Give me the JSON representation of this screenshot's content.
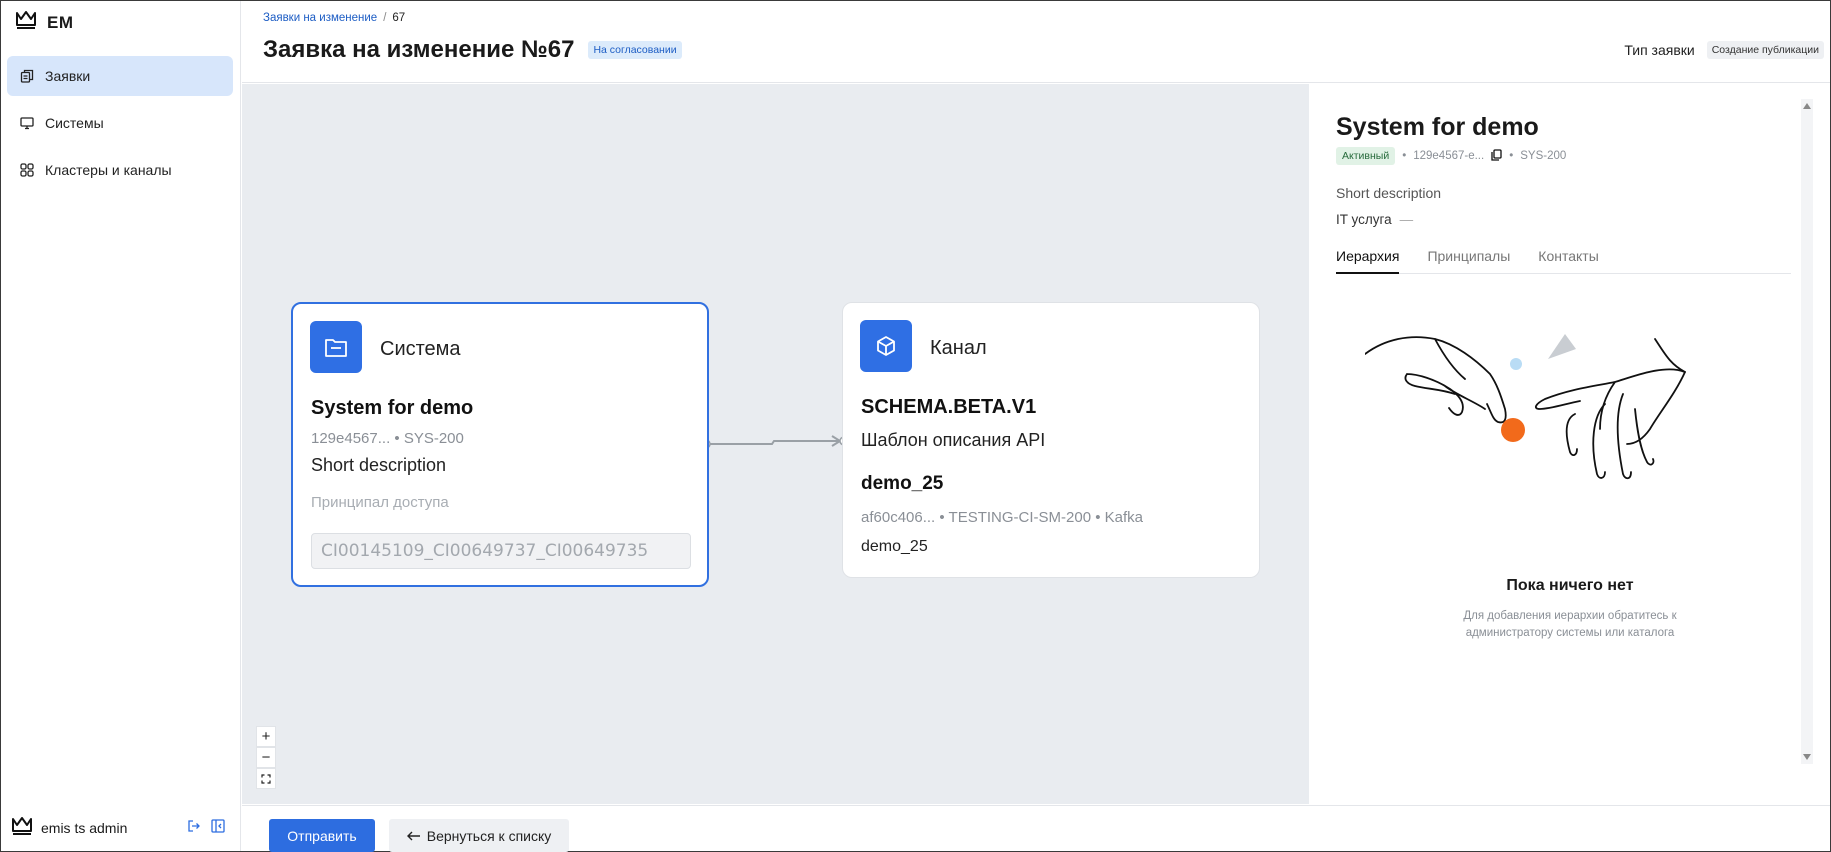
{
  "app": {
    "logo_text": "EM"
  },
  "sidebar": {
    "items": [
      {
        "label": "Заявки",
        "icon": "requests-icon",
        "active": true
      },
      {
        "label": "Системы",
        "icon": "monitor-icon",
        "active": false
      },
      {
        "label": "Кластеры и каналы",
        "icon": "grid-icon",
        "active": false
      }
    ],
    "user": {
      "name": "emis ts admin"
    }
  },
  "header": {
    "breadcrumb": {
      "parent": "Заявки на изменение",
      "separator": "/",
      "current": "67"
    },
    "title": "Заявка на изменение №67",
    "status_badge": "На согласовании",
    "type_label": "Тип заявки",
    "type_value": "Создание публикации"
  },
  "canvas": {
    "system_node": {
      "type_label": "Система",
      "name": "System for demo",
      "meta": "129e4567... • SYS-200",
      "description": "Short description",
      "principal_label": "Принципал доступа",
      "principal_value": "CI00145109_CI00649737_CI00649735"
    },
    "channel_node": {
      "type_label": "Канал",
      "name": "SCHEMA.BETA.V1",
      "subtitle": "Шаблон описания API",
      "cluster_name": "demo_25",
      "cluster_meta": "af60c406... • TESTING-CI-SM-200 • Kafka",
      "cluster_value": "demo_25"
    },
    "zoom": {
      "plus": "+",
      "minus": "−"
    }
  },
  "panel": {
    "title": "System for demo",
    "status": "Активный",
    "id": "129e4567-e...",
    "dot": "•",
    "code": "SYS-200",
    "description": "Short description",
    "it_service_label": "IT услуга",
    "it_service_value": "—",
    "tabs": [
      {
        "label": "Иерархия",
        "active": true
      },
      {
        "label": "Принципалы",
        "active": false
      },
      {
        "label": "Контакты",
        "active": false
      }
    ],
    "empty_title": "Пока ничего нет",
    "empty_line1": "Для добавления иерархии обратитесь к",
    "empty_line2": "администратору системы или каталога"
  },
  "footer": {
    "submit_label": "Отправить",
    "back_label": "Вернуться к списку"
  },
  "colors": {
    "accent": "#2d6de0",
    "canvas_bg": "#e9ecf0",
    "active_nav": "#d7e6fb",
    "illustration_orange": "#f26a1b",
    "illustration_blue": "#b9dcf5"
  }
}
